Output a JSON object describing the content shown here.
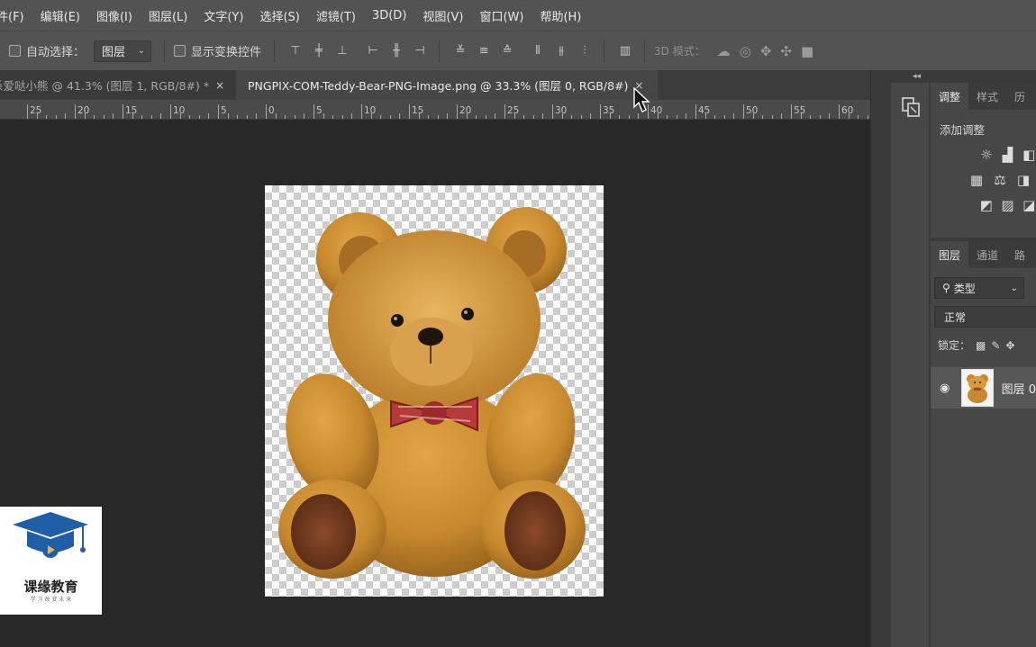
{
  "menu": [
    "件(F)",
    "编辑(E)",
    "图像(I)",
    "图层(L)",
    "文字(Y)",
    "选择(S)",
    "滤镜(T)",
    "3D(D)",
    "视图(V)",
    "窗口(W)",
    "帮助(H)"
  ],
  "options": {
    "auto_select_label": "自动选择：",
    "auto_select_value": "图层",
    "show_transform_label": "显示变换控件",
    "mode3d_label": "3D 模式："
  },
  "tabs": [
    {
      "title": "杀爱哒小熊 @ 41.3% (图层 1, RGB/8#) *",
      "close": "×"
    },
    {
      "title": "PNGPIX-COM-Teddy-Bear-PNG-Image.png @ 33.3% (图层 0, RGB/8#)",
      "close": "×"
    }
  ],
  "ruler_labels": [
    "25",
    "20",
    "15",
    "10",
    "5",
    "0",
    "5",
    "10",
    "15",
    "20",
    "25",
    "30",
    "35",
    "40",
    "45",
    "50",
    "55",
    "60"
  ],
  "adjust_panel": {
    "tabs": [
      "调整",
      "样式",
      "历"
    ],
    "title": "添加调整"
  },
  "layers_panel": {
    "tabs": [
      "图层",
      "通道",
      "路"
    ],
    "filter_label": "类型",
    "blend_mode": "正常",
    "lock_label": "锁定：",
    "layer_name": "图层 0"
  },
  "logo": {
    "text": "课缘教育",
    "subtext": "学 习 改 变 未 来"
  },
  "colors": {
    "menubar": "#535353",
    "canvas": "#282828",
    "logo_blue": "#1f5fa8",
    "bear": "#c8892e"
  }
}
